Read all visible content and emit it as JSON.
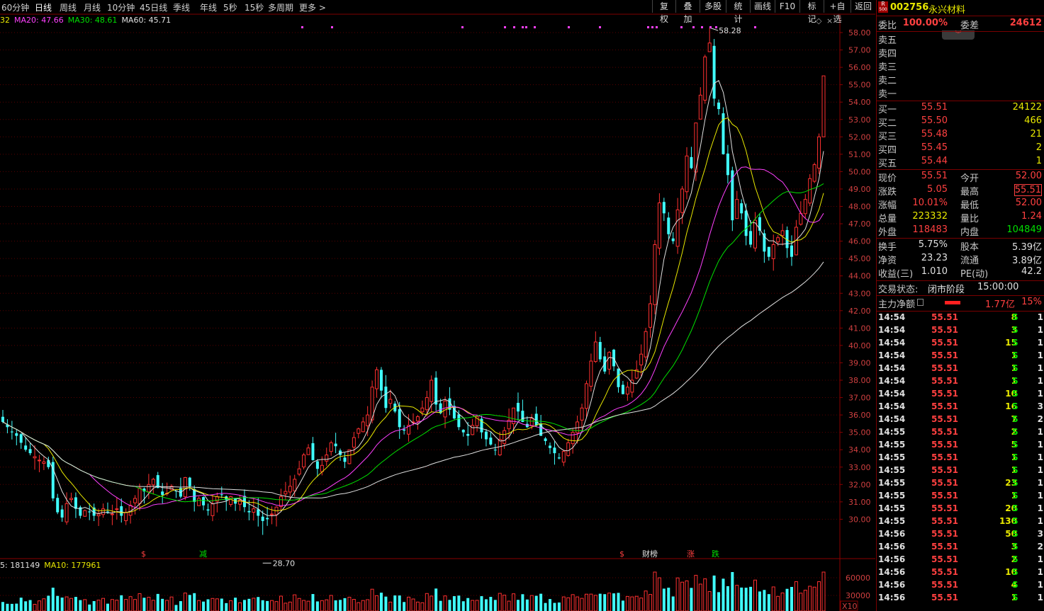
{
  "toolbar": {
    "periods": [
      {
        "label": "60分钟",
        "active": false
      },
      {
        "label": "日线",
        "active": true
      },
      {
        "label": "周线",
        "active": false
      },
      {
        "label": "月线",
        "active": false
      },
      {
        "label": "10分钟",
        "active": false
      },
      {
        "label": "45日线",
        "active": false
      },
      {
        "label": "季线",
        "active": false
      },
      {
        "label": "年线",
        "active": false
      },
      {
        "label": "5秒",
        "active": false
      },
      {
        "label": "15秒",
        "active": false
      },
      {
        "label": "多周期",
        "active": false
      },
      {
        "label": "更多 >",
        "active": false
      }
    ],
    "tools": [
      "复权",
      "叠加",
      "多股",
      "统计",
      "画线",
      "F10",
      "标记",
      "+自选",
      "返回"
    ]
  },
  "ma_legend": [
    {
      "label": "32",
      "color": "#e8e800"
    },
    {
      "label": "MA20: 47.66",
      "color": "#ff40ff"
    },
    {
      "label": "MA30: 48.61",
      "color": "#00e000"
    },
    {
      "label": "MA60: 45.71",
      "color": "#e0e0e0"
    }
  ],
  "vol_legend": [
    {
      "label": "5: 181149",
      "color": "#e0e0e0"
    },
    {
      "label": "MA10: 177961",
      "color": "#e8e800"
    }
  ],
  "price_axis": [
    "58.00",
    "57.00",
    "56.00",
    "55.00",
    "54.00",
    "53.00",
    "52.00",
    "51.00",
    "50.00",
    "49.00",
    "48.00",
    "47.00",
    "46.00",
    "45.00",
    "44.00",
    "43.00",
    "42.00",
    "41.00",
    "40.00",
    "39.00",
    "38.00",
    "37.00",
    "36.00",
    "35.00",
    "34.00",
    "33.00",
    "32.00",
    "31.00",
    "30.00"
  ],
  "vol_axis": [
    "60000",
    "30000",
    "X10"
  ],
  "annotations": {
    "high": "58.28",
    "low": "28.70"
  },
  "event_markers": [
    {
      "label": "$",
      "color": "#ff4040"
    },
    {
      "label": "减",
      "color": "#00e000"
    },
    {
      "label": "$",
      "color": "#ff4040"
    },
    {
      "label": "财榜",
      "color": "#e0e0e0"
    },
    {
      "label": "涨",
      "color": "#ff4040"
    },
    {
      "label": "跌",
      "color": "#00e000"
    }
  ],
  "stock": {
    "badge_top": "R",
    "badge_bottom": "500",
    "code": "002756",
    "name": "永兴材料"
  },
  "order_book": {
    "weibi_label": "委比",
    "weibi": "100.00%",
    "weicha_label": "委差",
    "weicha": "24612",
    "sell": [
      {
        "label": "卖五",
        "price": "",
        "vol": ""
      },
      {
        "label": "卖四",
        "price": "",
        "vol": ""
      },
      {
        "label": "卖三",
        "price": "",
        "vol": ""
      },
      {
        "label": "卖二",
        "price": "",
        "vol": ""
      },
      {
        "label": "卖一",
        "price": "",
        "vol": ""
      }
    ],
    "buy": [
      {
        "label": "买一",
        "price": "55.51",
        "vol": "24122"
      },
      {
        "label": "买二",
        "price": "55.50",
        "vol": "466"
      },
      {
        "label": "买三",
        "price": "55.48",
        "vol": "21"
      },
      {
        "label": "买四",
        "price": "55.45",
        "vol": "2"
      },
      {
        "label": "买五",
        "price": "55.44",
        "vol": "1"
      }
    ]
  },
  "quote": [
    {
      "l1": "现价",
      "v1": "55.51",
      "c1": "red",
      "l2": "今开",
      "v2": "52.00",
      "c2": "red"
    },
    {
      "l1": "涨跌",
      "v1": "5.05",
      "c1": "red",
      "l2": "最高",
      "v2": "55.51",
      "c2": "red"
    },
    {
      "l1": "涨幅",
      "v1": "10.01%",
      "c1": "red",
      "l2": "最低",
      "v2": "52.00",
      "c2": "red"
    },
    {
      "l1": "总量",
      "v1": "223332",
      "c1": "yellow",
      "l2": "量比",
      "v2": "1.24",
      "c2": "red"
    },
    {
      "l1": "外盘",
      "v1": "118483",
      "c1": "red",
      "l2": "内盘",
      "v2": "104849",
      "c2": "green"
    }
  ],
  "fundamentals": [
    {
      "l1": "换手",
      "v1": "5.75%",
      "l2": "股本",
      "v2": "5.39亿"
    },
    {
      "l1": "净资",
      "v1": "23.23",
      "l2": "流通",
      "v2": "3.89亿"
    },
    {
      "l1": "收益(三)",
      "v1": "1.010",
      "l2": "PE(动)",
      "v2": "42.2"
    }
  ],
  "status": {
    "label": "交易状态:",
    "value": "闭市阶段",
    "time": "15:00:00"
  },
  "main_force": {
    "label": "主力净额",
    "value": "1.77亿",
    "pct": "15%"
  },
  "ticks": [
    {
      "time": "14:54",
      "price": "55.51",
      "vol": "8",
      "side": "S",
      "n": "1"
    },
    {
      "time": "14:54",
      "price": "55.51",
      "vol": "3",
      "side": "S",
      "n": "1"
    },
    {
      "time": "14:54",
      "price": "55.51",
      "vol": "15",
      "side": "S",
      "n": "1"
    },
    {
      "time": "14:54",
      "price": "55.51",
      "vol": "1",
      "side": "S",
      "n": "1"
    },
    {
      "time": "14:54",
      "price": "55.51",
      "vol": "1",
      "side": "S",
      "n": "1"
    },
    {
      "time": "14:54",
      "price": "55.51",
      "vol": "1",
      "side": "S",
      "n": "1"
    },
    {
      "time": "14:54",
      "price": "55.51",
      "vol": "10",
      "side": "S",
      "n": "1"
    },
    {
      "time": "14:54",
      "price": "55.51",
      "vol": "16",
      "side": "S",
      "n": "3"
    },
    {
      "time": "14:54",
      "price": "55.51",
      "vol": "7",
      "side": "S",
      "n": "2"
    },
    {
      "time": "14:55",
      "price": "55.51",
      "vol": "2",
      "side": "S",
      "n": "1"
    },
    {
      "time": "14:55",
      "price": "55.51",
      "vol": "5",
      "side": "S",
      "n": "1"
    },
    {
      "time": "14:55",
      "price": "55.51",
      "vol": "1",
      "side": "S",
      "n": "1"
    },
    {
      "time": "14:55",
      "price": "55.51",
      "vol": "1",
      "side": "S",
      "n": "1"
    },
    {
      "time": "14:55",
      "price": "55.51",
      "vol": "23",
      "side": "S",
      "n": "1"
    },
    {
      "time": "14:55",
      "price": "55.51",
      "vol": "1",
      "side": "S",
      "n": "1"
    },
    {
      "time": "14:55",
      "price": "55.51",
      "vol": "20",
      "side": "S",
      "n": "1"
    },
    {
      "time": "14:55",
      "price": "55.51",
      "vol": "130",
      "side": "S",
      "n": "1"
    },
    {
      "time": "14:56",
      "price": "55.51",
      "vol": "50",
      "side": "S",
      "n": "3"
    },
    {
      "time": "14:56",
      "price": "55.51",
      "vol": "3",
      "side": "S",
      "n": "2"
    },
    {
      "time": "14:56",
      "price": "55.51",
      "vol": "2",
      "side": "S",
      "n": "1"
    },
    {
      "time": "14:56",
      "price": "55.51",
      "vol": "10",
      "side": "S",
      "n": "1"
    },
    {
      "time": "14:56",
      "price": "55.51",
      "vol": "4",
      "side": "S",
      "n": "1"
    },
    {
      "time": "14:56",
      "price": "55.51",
      "vol": "1",
      "side": "S",
      "n": "1"
    }
  ],
  "chart_data": {
    "type": "candlestick",
    "ylim": [
      29.2,
      58.6
    ],
    "high_label": 58.28,
    "low_label": 28.7,
    "colors": {
      "up": "#ff3030",
      "down": "#40ffff",
      "ma5": "#e0e0e0",
      "ma10": "#e8e800",
      "ma20": "#ff40ff",
      "ma30": "#00e000",
      "ma60": "#e0e0e0"
    },
    "closes": [
      35.6,
      35.3,
      35.0,
      34.8,
      34.4,
      34.0,
      33.8,
      33.6,
      33.4,
      33.3,
      33.0,
      31.2,
      30.4,
      30.1,
      30.9,
      31.2,
      30.6,
      30.2,
      30.5,
      30.4,
      30.2,
      30.3,
      30.6,
      30.4,
      30.3,
      30.6,
      30.2,
      30.4,
      30.8,
      31.2,
      31.8,
      31.6,
      32.0,
      32.3,
      31.8,
      31.4,
      31.5,
      31.9,
      31.6,
      31.3,
      32.4,
      31.9,
      31.0,
      31.2,
      30.8,
      30.5,
      30.9,
      31.3,
      31.4,
      31.1,
      31.3,
      30.9,
      31.1,
      30.7,
      30.4,
      30.6,
      30.2,
      29.9,
      30.0,
      30.3,
      30.7,
      31.3,
      31.6,
      31.9,
      32.3,
      32.9,
      33.7,
      34.1,
      33.4,
      32.9,
      33.1,
      33.7,
      34.4,
      34.2,
      33.7,
      33.3,
      34.0,
      34.7,
      35.2,
      35.6,
      36.0,
      37.6,
      38.6,
      37.4,
      36.4,
      36.9,
      36.2,
      35.3,
      35.1,
      35.4,
      35.6,
      35.9,
      36.4,
      37.0,
      38.0,
      36.6,
      36.1,
      36.8,
      36.3,
      35.8,
      35.3,
      35.0,
      34.8,
      35.4,
      35.9,
      35.0,
      34.6,
      34.3,
      34.0,
      34.6,
      35.1,
      35.7,
      36.4,
      36.2,
      35.6,
      35.3,
      35.8,
      35.4,
      34.8,
      34.5,
      34.1,
      33.8,
      33.5,
      33.9,
      34.4,
      35.0,
      35.6,
      36.4,
      37.8,
      39.1,
      40.2,
      39.2,
      38.5,
      39.6,
      38.8,
      37.6,
      37.2,
      37.6,
      38.0,
      38.6,
      39.5,
      40.8,
      42.4,
      45.8,
      48.2,
      47.6,
      46.4,
      46.0,
      47.8,
      49.0,
      50.9,
      50.2,
      52.8,
      54.4,
      56.6,
      57.4,
      54.2,
      53.6,
      51.0,
      49.8,
      47.2,
      48.4,
      47.6,
      46.3,
      45.8,
      47.2,
      46.6,
      45.4,
      45.1,
      45.8,
      46.2,
      46.6,
      45.6,
      45.1,
      46.8,
      47.6,
      48.4,
      49.6,
      50.4,
      52.0,
      55.51
    ],
    "volume_axis": [
      60000,
      30000
    ]
  }
}
